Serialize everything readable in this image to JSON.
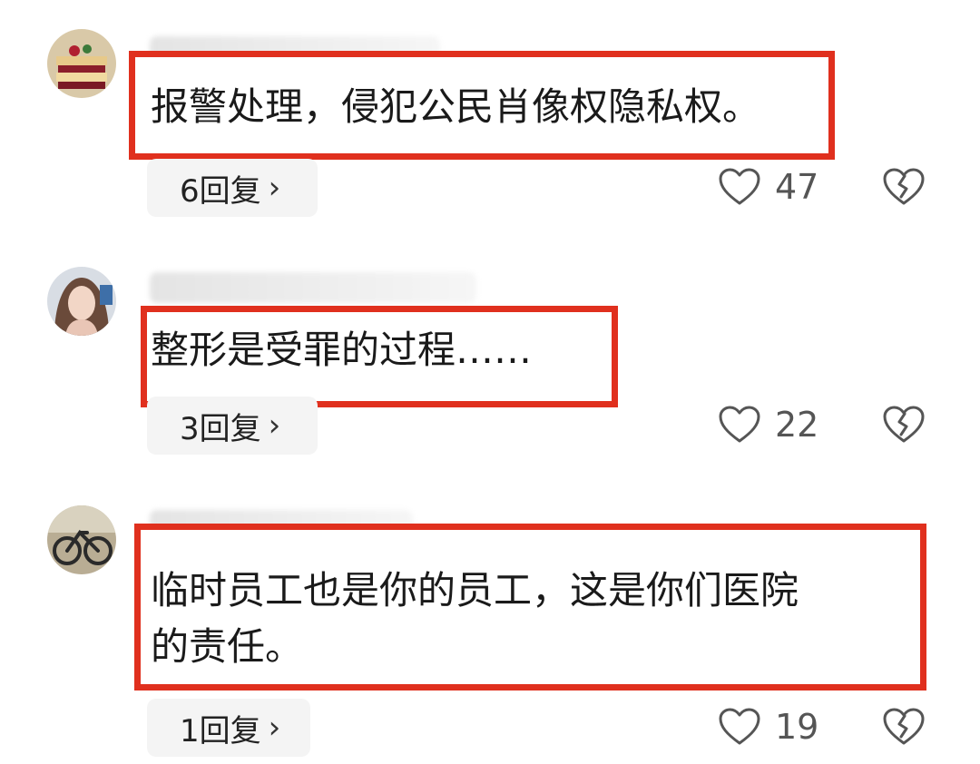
{
  "comments": [
    {
      "text": "报警处理，侵犯公民肖像权隐私权。",
      "reply_label": "6回复",
      "likes": "47"
    },
    {
      "text": "整形是受罪的过程……",
      "reply_label": "3回复",
      "likes": "22"
    },
    {
      "text": "临时员工也是你的员工，这是你们医院\n的责任。",
      "reply_label": "1回复",
      "likes": "19"
    }
  ],
  "icons": {
    "reply_chevron": "›",
    "like": "heart-outline-icon",
    "dislike": "broken-heart-icon"
  },
  "colors": {
    "highlight_border": "#e0301e",
    "reply_chip_bg": "#f4f4f4"
  }
}
